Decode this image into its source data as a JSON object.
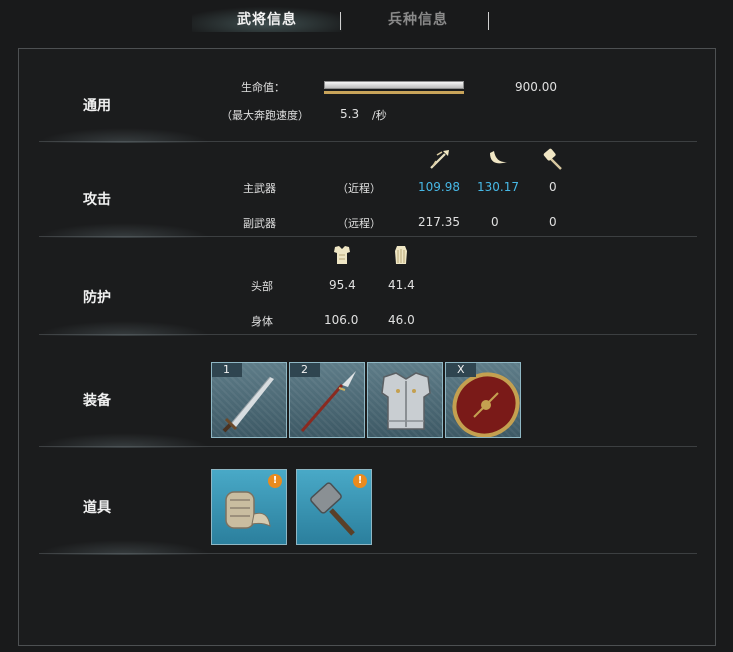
{
  "tabs": {
    "active": "武将信息",
    "inactive": "兵种信息"
  },
  "general": {
    "title": "通用",
    "hp_label": "生命值：",
    "hp_value": "900.00",
    "hp_fill": 1.0,
    "speed_label": "（最大奔跑速度）",
    "speed_value": "5.3",
    "speed_unit": "/秒"
  },
  "attack": {
    "title": "攻击",
    "icons": [
      "pierce-icon",
      "slash-icon",
      "blunt-icon"
    ],
    "rows": [
      {
        "label": "主武器",
        "type": "（近程）",
        "values": [
          "109.98",
          "130.17",
          "0"
        ]
      },
      {
        "label": "副武器",
        "type": "（远程）",
        "values": [
          "217.35",
          "0",
          "0"
        ]
      }
    ],
    "highlight_color": "#47b8e6"
  },
  "defense": {
    "title": "防护",
    "icons": [
      "armor-icon",
      "padded-armor-icon"
    ],
    "rows": [
      {
        "label": "头部",
        "values": [
          "95.4",
          "41.4"
        ]
      },
      {
        "label": "身体",
        "values": [
          "106.0",
          "46.0"
        ]
      }
    ]
  },
  "equipment": {
    "title": "装备",
    "slots": [
      {
        "key": "1",
        "icon": "sword-icon"
      },
      {
        "key": "2",
        "icon": "spear-icon"
      },
      {
        "key": "",
        "icon": "breastplate-icon"
      },
      {
        "key": "X",
        "icon": "shield-icon"
      }
    ]
  },
  "items": {
    "title": "道具",
    "slots": [
      {
        "icon": "bandage-icon",
        "badge": "!"
      },
      {
        "icon": "hammer-icon",
        "badge": "!"
      }
    ]
  }
}
